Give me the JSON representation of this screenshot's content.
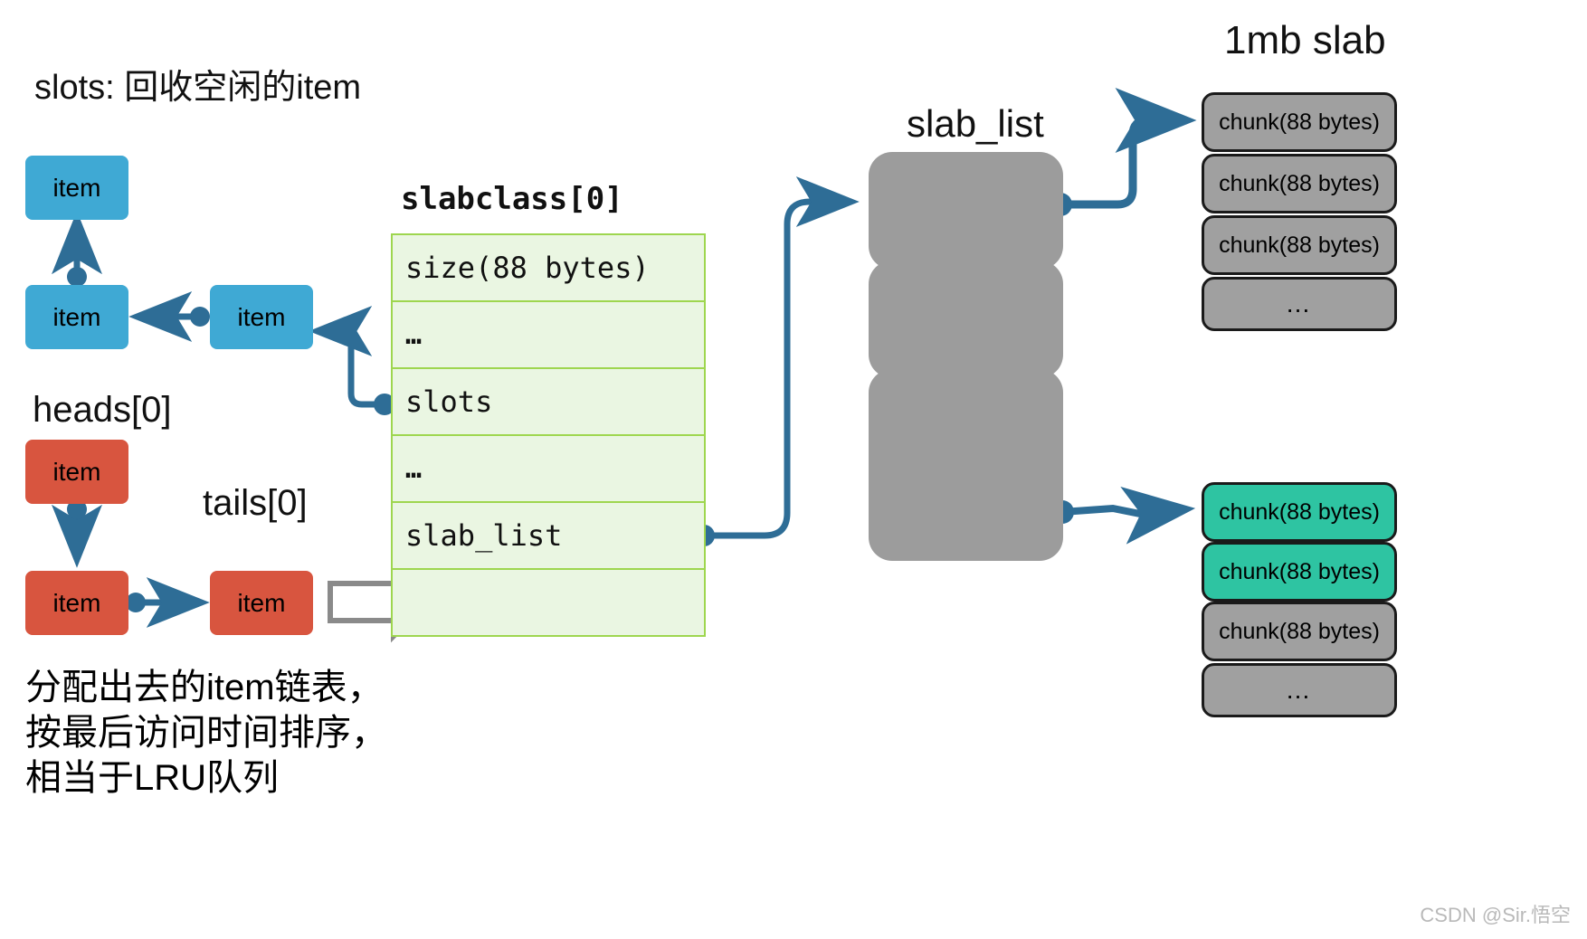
{
  "diagram": {
    "title_right": "1mb slab",
    "slots_caption": "slots: 回收空闲的item",
    "slab_list_label": "slab_list",
    "slabclass_label": "slabclass[0]",
    "heads_label": "heads[0]",
    "tails_label": "tails[0]",
    "bottom_caption_line1": "分配出去的item链表，",
    "bottom_caption_line2": "按最后访问时间排序，",
    "bottom_caption_line3": "相当于LRU队列",
    "watermark": "CSDN @Sir.悟空"
  },
  "free_items": [
    {
      "label": "item"
    },
    {
      "label": "item"
    },
    {
      "label": "item"
    }
  ],
  "lru_items": [
    {
      "label": "item"
    },
    {
      "label": "item"
    },
    {
      "label": "item"
    }
  ],
  "slabclass_rows": [
    {
      "text": "size(88 bytes)",
      "dots": false
    },
    {
      "text": "…",
      "dots": true
    },
    {
      "text": "slots",
      "dots": false
    },
    {
      "text": "…",
      "dots": true
    },
    {
      "text": "slab_list",
      "dots": false
    },
    {
      "text": "",
      "dots": false
    }
  ],
  "slab_blocks": [
    {
      "name": "slab-block-1"
    },
    {
      "name": "slab-block-2"
    },
    {
      "name": "slab-block-3"
    }
  ],
  "slab_top_chunks": [
    {
      "text": "chunk(88 bytes)",
      "state": "free"
    },
    {
      "text": "chunk(88 bytes)",
      "state": "free"
    },
    {
      "text": "chunk(88 bytes)",
      "state": "free"
    },
    {
      "text": "…",
      "state": "free"
    }
  ],
  "slab_bottom_chunks": [
    {
      "text": "chunk(88 bytes)",
      "state": "used"
    },
    {
      "text": "chunk(88 bytes)",
      "state": "used"
    },
    {
      "text": "chunk(88 bytes)",
      "state": "free"
    },
    {
      "text": "…",
      "state": "free"
    }
  ],
  "colors": {
    "item_blue": "#3fa9d4",
    "item_red": "#d8553f",
    "chunk_gray": "#a0a0a0",
    "chunk_green": "#2ec4a2",
    "slab_block_gray": "#9c9c9c",
    "table_fill": "#eaf6e2",
    "table_border": "#9ed64f",
    "arrow_blue": "#2e6d96",
    "block_arrow_gray": "#8a8a8a"
  }
}
